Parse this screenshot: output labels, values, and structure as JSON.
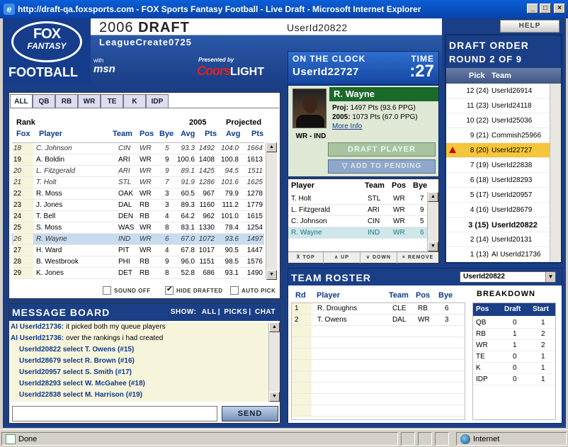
{
  "window": {
    "title": "http://draft-qa.foxsports.com - FOX Sports Fantasy Football - Live Draft - Microsoft Internet Explorer"
  },
  "header": {
    "logo_line1": "FOX",
    "logo_line2": "FANTASY",
    "logo_line3": "FOOTBALL",
    "draft_year": "2006",
    "draft_word": "DRAFT",
    "user_id": "UserId20822",
    "help_label": "HELP",
    "league": "LeagueCreate0725",
    "sponsor_msn_small": "with",
    "sponsor_msn": "msn",
    "presented_by": "Presented by",
    "sponsor_coors": "Coors",
    "sponsor_light": "LIGHT"
  },
  "clock": {
    "heading": "ON THE CLOCK",
    "time_label": "TIME",
    "user": "UserId22727",
    "time": ":27"
  },
  "draft_order": {
    "title": "DRAFT ORDER",
    "round": "ROUND 2 OF 9",
    "col_pick": "Pick",
    "col_team": "Team",
    "rows": [
      {
        "pick": "12 (24)",
        "team": "UserId26914"
      },
      {
        "pick": "11 (23)",
        "team": "UserId24118"
      },
      {
        "pick": "10 (22)",
        "team": "UserId25036"
      },
      {
        "pick": "9 (21)",
        "team": "Commish25966"
      },
      {
        "pick": "8 (20)",
        "team": "UserId22727"
      },
      {
        "pick": "7 (19)",
        "team": "UserId22838"
      },
      {
        "pick": "6 (18)",
        "team": "UserId28293"
      },
      {
        "pick": "5 (17)",
        "team": "UserId20957"
      },
      {
        "pick": "4 (16)",
        "team": "UserId28679"
      },
      {
        "pick": "3 (15)",
        "team": "UserId20822"
      },
      {
        "pick": "2 (14)",
        "team": "UserId20131"
      },
      {
        "pick": "1 (13)",
        "team": "AI UserId21736"
      }
    ]
  },
  "player_list": {
    "tabs": [
      "ALL",
      "QB",
      "RB",
      "WR",
      "TE",
      "K",
      "IDP"
    ],
    "hdr_rank": "Rank",
    "hdr_2005": "2005",
    "hdr_projected": "Projected",
    "cols": {
      "fox": "Fox",
      "player": "Player",
      "team": "Team",
      "pos": "Pos",
      "bye": "Bye",
      "avg": "Avg",
      "pts": "Pts",
      "pavg": "Avg",
      "ppts": "Pts"
    },
    "rows": [
      {
        "rank": "18",
        "name": "C. Johnson",
        "team": "CIN",
        "pos": "WR",
        "bye": "5",
        "avg": "93.3",
        "pts": "1492",
        "pavg": "104.0",
        "ppts": "1664"
      },
      {
        "rank": "19",
        "name": "A. Boldin",
        "team": "ARI",
        "pos": "WR",
        "bye": "9",
        "avg": "100.6",
        "pts": "1408",
        "pavg": "100.8",
        "ppts": "1613"
      },
      {
        "rank": "20",
        "name": "L. Fitzgerald",
        "team": "ARI",
        "pos": "WR",
        "bye": "9",
        "avg": "89.1",
        "pts": "1425",
        "pavg": "94.5",
        "ppts": "1511"
      },
      {
        "rank": "21",
        "name": "T. Holt",
        "team": "STL",
        "pos": "WR",
        "bye": "7",
        "avg": "91.9",
        "pts": "1286",
        "pavg": "101.6",
        "ppts": "1625"
      },
      {
        "rank": "22",
        "name": "R. Moss",
        "team": "OAK",
        "pos": "WR",
        "bye": "3",
        "avg": "60.5",
        "pts": "967",
        "pavg": "79.9",
        "ppts": "1278"
      },
      {
        "rank": "23",
        "name": "J. Jones",
        "team": "DAL",
        "pos": "RB",
        "bye": "3",
        "avg": "89.3",
        "pts": "1160",
        "pavg": "111.2",
        "ppts": "1779"
      },
      {
        "rank": "24",
        "name": "T. Bell",
        "team": "DEN",
        "pos": "RB",
        "bye": "4",
        "avg": "64.2",
        "pts": "962",
        "pavg": "101.0",
        "ppts": "1615"
      },
      {
        "rank": "25",
        "name": "S. Moss",
        "team": "WAS",
        "pos": "WR",
        "bye": "8",
        "avg": "83.1",
        "pts": "1330",
        "pavg": "78.4",
        "ppts": "1254"
      },
      {
        "rank": "26",
        "name": "R. Wayne",
        "team": "IND",
        "pos": "WR",
        "bye": "6",
        "avg": "67.0",
        "pts": "1072",
        "pavg": "93.6",
        "ppts": "1497"
      },
      {
        "rank": "27",
        "name": "H. Ward",
        "team": "PIT",
        "pos": "WR",
        "bye": "4",
        "avg": "67.8",
        "pts": "1017",
        "pavg": "90.5",
        "ppts": "1447"
      },
      {
        "rank": "28",
        "name": "B. Westbrook",
        "team": "PHI",
        "pos": "RB",
        "bye": "9",
        "avg": "96.0",
        "pts": "1151",
        "pavg": "98.5",
        "ppts": "1576"
      },
      {
        "rank": "29",
        "name": "K. Jones",
        "team": "DET",
        "pos": "RB",
        "bye": "8",
        "avg": "52.8",
        "pts": "686",
        "pavg": "93.1",
        "ppts": "1490"
      }
    ],
    "opt_sound": "SOUND OFF",
    "opt_hide": "HIDE DRAFTED",
    "opt_auto": "AUTO PICK"
  },
  "message_board": {
    "title": "MESSAGE BOARD",
    "show_label": "SHOW:",
    "filter_all": "ALL",
    "filter_picks": "PICKS",
    "filter_chat": "CHAT",
    "messages": [
      {
        "who": "AI UserId21736:",
        "text": "it picked both my queue players"
      },
      {
        "who": "AI UserId21736:",
        "text": "over the rankings i had created"
      }
    ],
    "picks": [
      "UserId20822 select T. Owens (#15)",
      "UserId28679 select R. Brown (#16)",
      "UserId20957 select S. Smith (#17)",
      "UserId28293 select W. McGahee (#18)",
      "UserId22838 select M. Harrison (#19)"
    ],
    "send_label": "SEND"
  },
  "player_card": {
    "name": "R. Wayne",
    "pos_team": "WR - IND",
    "proj_label": "Proj:",
    "proj_value": "1497 Pts (93.6 PPG)",
    "y2005_label": "2005:",
    "y2005_value": "1073 Pts (67.0 PPG)",
    "more_info": "More Info",
    "draft_label": "DRAFT PLAYER",
    "pending_label": "▽ ADD TO PENDING"
  },
  "queue": {
    "cols": {
      "player": "Player",
      "team": "Team",
      "pos": "Pos",
      "bye": "Bye"
    },
    "rows": [
      {
        "name": "T. Holt",
        "team": "STL",
        "pos": "WR",
        "bye": "7"
      },
      {
        "name": "L. Fitzgerald",
        "team": "ARI",
        "pos": "WR",
        "bye": "9"
      },
      {
        "name": "C. Johnson",
        "team": "CIN",
        "pos": "WR",
        "bye": "5"
      },
      {
        "name": "R. Wayne",
        "team": "IND",
        "pos": "WR",
        "bye": "6"
      }
    ],
    "btn_top": "TOP",
    "btn_up": "UP",
    "btn_down": "DOWN",
    "btn_remove": "REMOVE"
  },
  "roster": {
    "title": "TEAM ROSTER",
    "selected_team": "UserId20822",
    "cols": {
      "rd": "Rd",
      "player": "Player",
      "team": "Team",
      "pos": "Pos",
      "bye": "Bye"
    },
    "rows": [
      {
        "rd": "1",
        "name": "R. Droughns",
        "team": "CLE",
        "pos": "RB",
        "bye": "6"
      },
      {
        "rd": "2",
        "name": "T. Owens",
        "team": "DAL",
        "pos": "WR",
        "bye": "3"
      }
    ],
    "breakdown_title": "BREAKDOWN",
    "bd_cols": {
      "pos": "Pos",
      "draft": "Draft",
      "start": "Start"
    },
    "breakdown": [
      {
        "pos": "QB",
        "draft": "0",
        "start": "1"
      },
      {
        "pos": "RB",
        "draft": "1",
        "start": "2"
      },
      {
        "pos": "WR",
        "draft": "1",
        "start": "2"
      },
      {
        "pos": "TE",
        "draft": "0",
        "start": "1"
      },
      {
        "pos": "K",
        "draft": "0",
        "start": "1"
      },
      {
        "pos": "IDP",
        "draft": "0",
        "start": "1"
      }
    ]
  },
  "status": {
    "left": "Done",
    "zone": "Internet"
  }
}
